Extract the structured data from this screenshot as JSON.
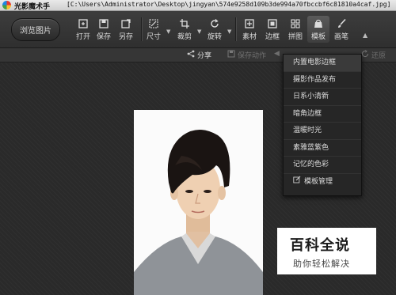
{
  "window": {
    "app_name": "光影魔术手",
    "path": "[C:\\Users\\Administrator\\Desktop\\jingyan\\574e9258d109b3de994a70fbccbf6c81810a4caf.jpg]"
  },
  "toolbar": {
    "browse_label": "浏览图片",
    "tools": [
      {
        "label": "打开",
        "icon": "open-icon"
      },
      {
        "label": "保存",
        "icon": "save-icon"
      },
      {
        "label": "另存",
        "icon": "save-as-icon"
      },
      {
        "label": "尺寸",
        "icon": "resize-icon"
      },
      {
        "label": "裁剪",
        "icon": "crop-icon"
      },
      {
        "label": "旋转",
        "icon": "rotate-icon"
      },
      {
        "label": "素材",
        "icon": "material-icon"
      },
      {
        "label": "边框",
        "icon": "border-icon"
      },
      {
        "label": "拼图",
        "icon": "collage-icon"
      },
      {
        "label": "模板",
        "icon": "template-icon"
      },
      {
        "label": "画笔",
        "icon": "brush-icon"
      }
    ]
  },
  "subbar": {
    "share": "分享",
    "save_action": "保存动作",
    "restore": "还原"
  },
  "template_menu": {
    "items": [
      "内置电影边框",
      "摄影作品发布",
      "日系小清新",
      "暗角边框",
      "温暖时光",
      "素雅蓝紫色",
      "记忆的色彩"
    ],
    "manage": "模板管理"
  },
  "watermark": {
    "title": "百科全说",
    "subtitle": "助你轻松解决"
  }
}
